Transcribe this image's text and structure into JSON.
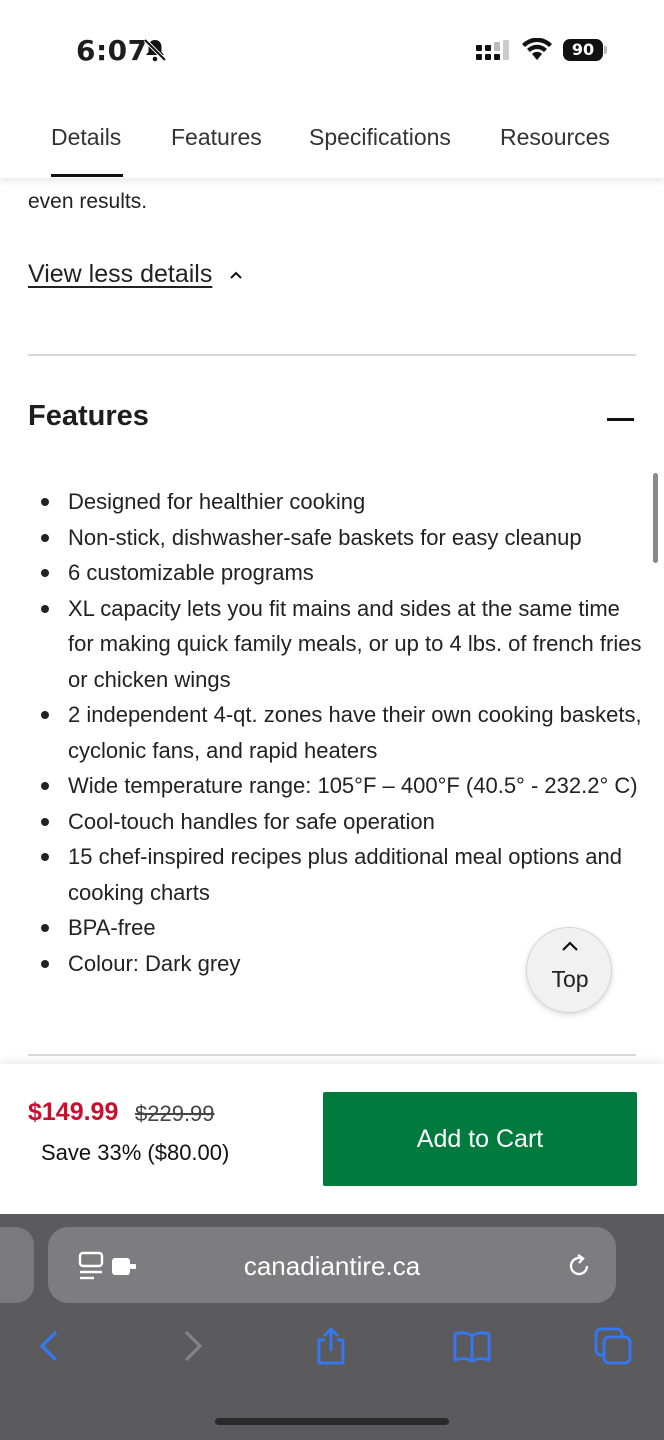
{
  "status_bar": {
    "time": "6:07",
    "battery_level": "90",
    "icons": [
      "bell-slash-icon",
      "cellular-signal-icon",
      "wifi-icon",
      "battery-icon"
    ]
  },
  "tabs": [
    {
      "label": "Details",
      "active": true
    },
    {
      "label": "Features",
      "active": false
    },
    {
      "label": "Specifications",
      "active": false
    },
    {
      "label": "Resources",
      "active": false
    }
  ],
  "details": {
    "partial_text": "even results.",
    "view_less_label": "View less details"
  },
  "features": {
    "heading": "Features",
    "items": [
      "Designed for healthier cooking",
      "Non-stick, dishwasher-safe baskets for easy cleanup",
      "6 customizable programs",
      "XL capacity lets you fit mains and sides at the same time for making quick family meals, or up to 4 lbs. of french fries or chicken wings",
      "2 independent 4-qt. zones have their own cooking baskets, cyclonic fans, and rapid heaters",
      "Wide temperature range: 105°F – 400°F (40.5° - 232.2° C)",
      "Cool-touch handles for safe operation",
      "15 chef-inspired recipes plus additional meal options and cooking charts",
      "BPA-free",
      "Colour: Dark grey"
    ]
  },
  "top_button": {
    "label": "Top"
  },
  "price_bar": {
    "sale_price": "$149.99",
    "original_price": "$229.99",
    "savings": "Save 33% ($80.00)",
    "add_to_cart_label": "Add to Cart"
  },
  "browser": {
    "url": "canadiantire.ca"
  },
  "colors": {
    "sale_red": "#c8102e",
    "cart_green": "#007a3d",
    "toolbar_gray": "#5b5b5e",
    "ios_blue": "#3478f6"
  }
}
